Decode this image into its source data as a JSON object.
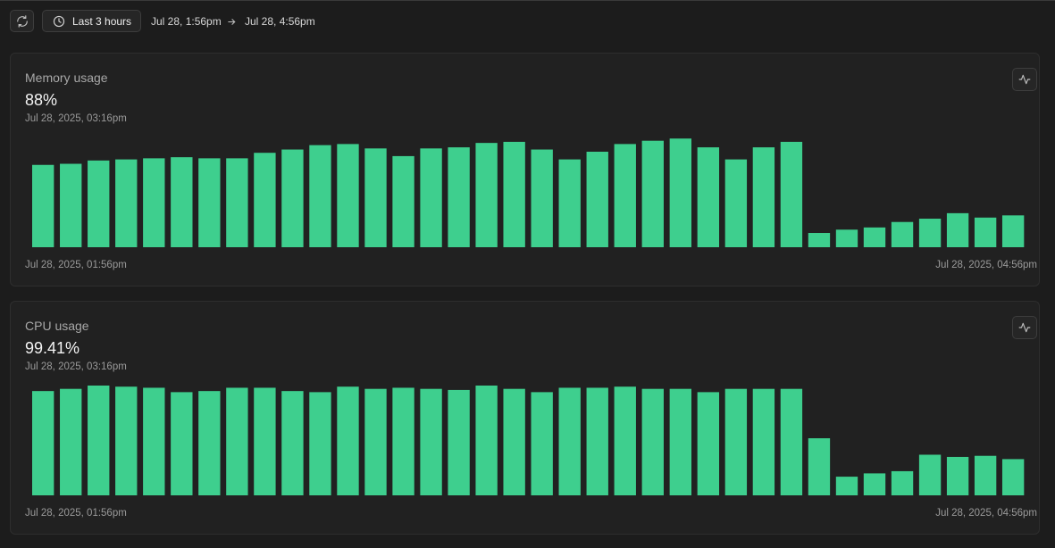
{
  "toolbar": {
    "range_label": "Last 3 hours",
    "range_start": "Jul 28, 1:56pm",
    "range_end": "Jul 28, 4:56pm"
  },
  "colors": {
    "bar": "#3ecf8e",
    "background": "#1c1c1c",
    "panel": "#212121"
  },
  "icons": {
    "refresh": "refresh-icon",
    "clock": "clock-icon",
    "arrow": "arrow-right-icon",
    "chart": "activity-chart-icon"
  },
  "memory": {
    "title": "Memory usage",
    "value": "88%",
    "time": "Jul 28, 2025, 03:16pm",
    "axis_start": "Jul 28, 2025, 01:56pm",
    "axis_end": "Jul 28, 2025, 04:56pm"
  },
  "cpu": {
    "title": "CPU usage",
    "value": "99.41%",
    "time": "Jul 28, 2025, 03:16pm",
    "axis_start": "Jul 28, 2025, 01:56pm",
    "axis_end": "Jul 28, 2025, 04:56pm"
  },
  "chart_data": [
    {
      "type": "bar",
      "title": "Memory usage",
      "xlabel": "",
      "ylabel": "",
      "ylim": [
        0,
        100
      ],
      "x_start": "Jul 28, 2025, 01:56pm",
      "x_end": "Jul 28, 2025, 04:56pm",
      "values": [
        75,
        76,
        79,
        80,
        81,
        82,
        81,
        81,
        86,
        89,
        93,
        94,
        90,
        83,
        90,
        91,
        95,
        96,
        89,
        80,
        87,
        94,
        97,
        99,
        91,
        80,
        91,
        96,
        13,
        16,
        18,
        23,
        26,
        31,
        27,
        29
      ]
    },
    {
      "type": "bar",
      "title": "CPU usage",
      "xlabel": "",
      "ylabel": "",
      "ylim": [
        0,
        100
      ],
      "x_start": "Jul 28, 2025, 01:56pm",
      "x_end": "Jul 28, 2025, 04:56pm",
      "values": [
        95,
        97,
        100,
        99,
        98,
        94,
        95,
        98,
        98,
        95,
        94,
        99,
        97,
        98,
        97,
        96,
        100,
        97,
        94,
        98,
        98,
        99,
        97,
        97,
        94,
        97,
        97,
        97,
        52,
        17,
        20,
        22,
        37,
        35,
        36,
        33
      ]
    }
  ]
}
